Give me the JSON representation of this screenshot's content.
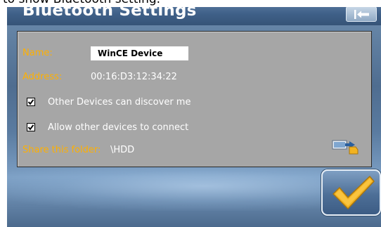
{
  "caption": "to show Bluetooth setting.",
  "window": {
    "title": "Bluetooth Settings",
    "back_icon": "back-arrow-icon"
  },
  "settings": {
    "name_label": "Name:",
    "name_value": "WinCE Device",
    "address_label": "Address:",
    "address_value": "00:16:D3:12:34:22",
    "discoverable_label": "Other Devices can discover me",
    "discoverable_checked": true,
    "allow_connect_label": "Allow other devices to connect",
    "allow_connect_checked": true,
    "share_folder_label": "Share this folder:",
    "share_folder_value": "\\HDD",
    "browse_icon": "folder-browse-icon"
  },
  "actions": {
    "ok_icon": "checkmark-icon"
  },
  "colors": {
    "label_accent": "#ffb000",
    "panel_bg": "#a6a6a6",
    "titlebar_bg": "#3f6088",
    "checkmark": "#f2b321"
  }
}
